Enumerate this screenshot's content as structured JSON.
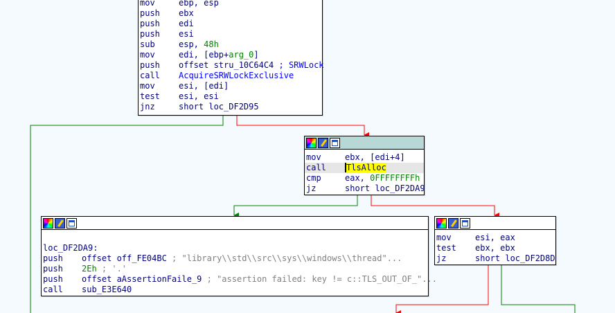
{
  "colors": {
    "background": "#f5fafe",
    "edge_true": "#008000",
    "edge_false": "#ff0000",
    "header_active": "#b8d8d8",
    "highlight": "#ffff00"
  },
  "block_header_icons": [
    "color-palette-icon",
    "edit-pencil-icon",
    "graph-overview-icon"
  ],
  "block_top": {
    "lines": [
      {
        "mnemonic": "mov",
        "ops": [
          {
            "t": "ebp, esp"
          }
        ]
      },
      {
        "mnemonic": "push",
        "ops": [
          {
            "t": "ebx"
          }
        ]
      },
      {
        "mnemonic": "push",
        "ops": [
          {
            "t": "edi"
          }
        ]
      },
      {
        "mnemonic": "push",
        "ops": [
          {
            "t": "esi"
          }
        ]
      },
      {
        "mnemonic": "sub",
        "ops": [
          {
            "t": "esp, "
          },
          {
            "t": "48h",
            "c": "kw-hex"
          }
        ]
      },
      {
        "mnemonic": "mov",
        "ops": [
          {
            "t": "edi, [ebp+"
          },
          {
            "t": "arg_0",
            "c": "kw-hex"
          },
          {
            "t": "]"
          }
        ]
      },
      {
        "mnemonic": "push",
        "ops": [
          {
            "t": "offset stru_10C64C4 "
          },
          {
            "t": "; SRWLock",
            "c": "cmt-blue"
          }
        ]
      },
      {
        "mnemonic": "call",
        "ops": [
          {
            "t": "AcquireSRWLockExclusive",
            "c": "ref-blue"
          }
        ]
      },
      {
        "mnemonic": "mov",
        "ops": [
          {
            "t": "esi, [edi]"
          }
        ]
      },
      {
        "mnemonic": "test",
        "ops": [
          {
            "t": "esi, esi"
          }
        ]
      },
      {
        "mnemonic": "jnz",
        "ops": [
          {
            "t": "short loc_DF2D95"
          }
        ]
      }
    ]
  },
  "block_mid": {
    "lines": [
      {
        "mnemonic": "mov",
        "ops": [
          {
            "t": "ebx, [edi+4]"
          }
        ]
      },
      {
        "mnemonic": "call",
        "ops": [
          {
            "t": "TlsAlloc",
            "c": "hl"
          }
        ],
        "highlight": true
      },
      {
        "mnemonic": "cmp",
        "ops": [
          {
            "t": "eax, "
          },
          {
            "t": "0FFFFFFFFh",
            "c": "kw-hex"
          }
        ]
      },
      {
        "mnemonic": "jz",
        "ops": [
          {
            "t": "short loc_DF2DA9"
          }
        ]
      }
    ]
  },
  "block_left": {
    "label": "loc_DF2DA9:",
    "lines": [
      {
        "mnemonic": "push",
        "ops": [
          {
            "t": "offset off_FE04BC "
          },
          {
            "t": "; \"library\\\\std\\\\src\\\\sys\\\\windows\\\\thread\"...",
            "c": "cmt"
          }
        ]
      },
      {
        "mnemonic": "push",
        "ops": [
          {
            "t": "2Eh",
            "c": "kw-hex"
          },
          {
            "t": " ; '.'",
            "c": "cmt"
          }
        ]
      },
      {
        "mnemonic": "push",
        "ops": [
          {
            "t": "offset aAssertionFaile_9 "
          },
          {
            "t": "; \"assertion failed: key != c::TLS_OUT_OF_\"...",
            "c": "cmt"
          }
        ]
      },
      {
        "mnemonic": "call",
        "ops": [
          {
            "t": "sub_E3E640"
          }
        ]
      }
    ]
  },
  "block_right": {
    "lines": [
      {
        "mnemonic": "mov",
        "ops": [
          {
            "t": "esi, eax"
          }
        ]
      },
      {
        "mnemonic": "test",
        "ops": [
          {
            "t": "ebx, ebx"
          }
        ]
      },
      {
        "mnemonic": "jz",
        "ops": [
          {
            "t": "short loc_DF2D8D"
          }
        ]
      }
    ]
  }
}
